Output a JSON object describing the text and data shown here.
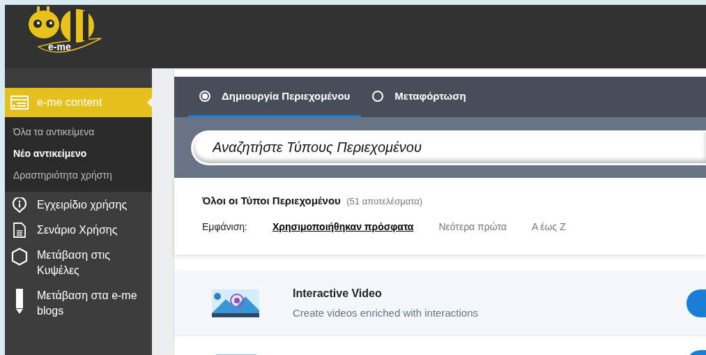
{
  "logo": {
    "text": "e-me"
  },
  "sidebar": {
    "section": {
      "label": "e-me content",
      "selected": true
    },
    "subitems": [
      {
        "label": "Όλα τα αντικείμενα",
        "selected": false
      },
      {
        "label": "Νέο αντικείμενο",
        "selected": true
      },
      {
        "label": "Δραστηριότητα χρήστη",
        "selected": false
      }
    ],
    "items": [
      {
        "label": "Εγχειρίδιο χρήσης",
        "kind": "info"
      },
      {
        "label": "Σενάριο Χρήσης",
        "kind": "document"
      },
      {
        "label": "Μετάβαση στις Κυψέλες",
        "kind": "hexagon"
      },
      {
        "label": "Μετάβαση στα e-me blogs",
        "kind": "pencil"
      }
    ]
  },
  "tabs": [
    {
      "label": "Δημιουργία Περιεχομένου",
      "selected": true
    },
    {
      "label": "Μεταφόρτωση",
      "selected": false
    }
  ],
  "search": {
    "placeholder": "Αναζητήστε Τύπους Περιεχομένου"
  },
  "results": {
    "title": "Όλοι οι Τύποι Περιεχομένου",
    "count": "(51 αποτελέσματα)"
  },
  "sort": {
    "label": "Εμφάνιση:",
    "options": [
      {
        "label": "Χρησιμοποιήθηκαν πρόσφατα",
        "selected": true
      },
      {
        "label": "Νεότερα πρώτα",
        "selected": false
      },
      {
        "label": "Α έως Ζ",
        "selected": false
      }
    ]
  },
  "content_types": [
    {
      "title": "Interactive Video",
      "description": "Create videos enriched with interactions",
      "kind": "video"
    },
    {
      "kind": "panel"
    }
  ]
}
